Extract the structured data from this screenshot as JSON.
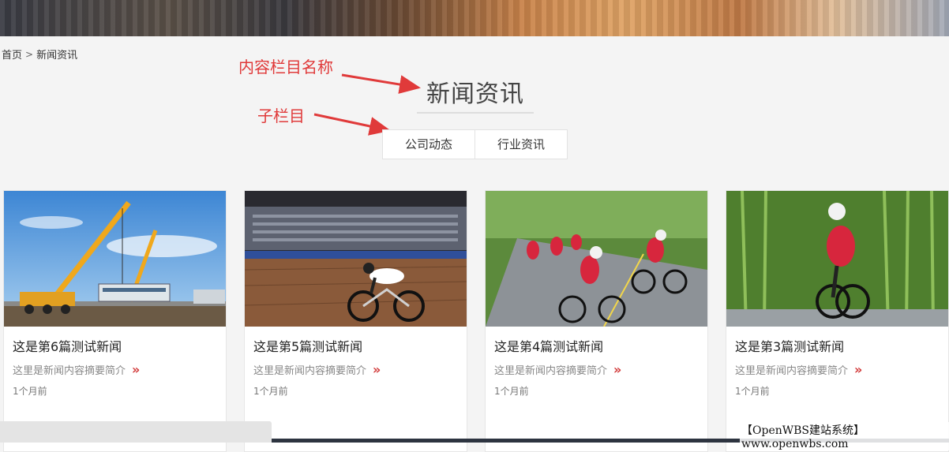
{
  "breadcrumb": {
    "home": "首页",
    "separator": ">",
    "current": "新闻资讯"
  },
  "annotations": {
    "content_column_name": "内容栏目名称",
    "sub_column": "子栏目"
  },
  "section": {
    "title": "新闻资讯"
  },
  "subnav": {
    "tabs": [
      "公司动态",
      "行业资讯"
    ]
  },
  "cards": [
    {
      "title": "这是第6篇测试新闻",
      "summary": "这里是新闻内容摘要简介",
      "more": "»",
      "time": "1个月前",
      "image": "crane-lifting-train-car"
    },
    {
      "title": "这是第5篇测试新闻",
      "summary": "这里是新闻内容摘要简介",
      "more": "»",
      "time": "1个月前",
      "image": "track-cyclist-velodrome"
    },
    {
      "title": "这是第4篇测试新闻",
      "summary": "这里是新闻内容摘要简介",
      "more": "»",
      "time": "1个月前",
      "image": "road-cyclists-group"
    },
    {
      "title": "这是第3篇测试新闻",
      "summary": "这里是新闻内容摘要简介",
      "more": "»",
      "time": "1个月前",
      "image": "cyclist-bamboo-forest"
    }
  ],
  "watermark": "【OpenWBS建站系统】www.openwbs.com",
  "colors": {
    "annotation": "#e03a3a",
    "accent_more": "#d23a3a"
  }
}
